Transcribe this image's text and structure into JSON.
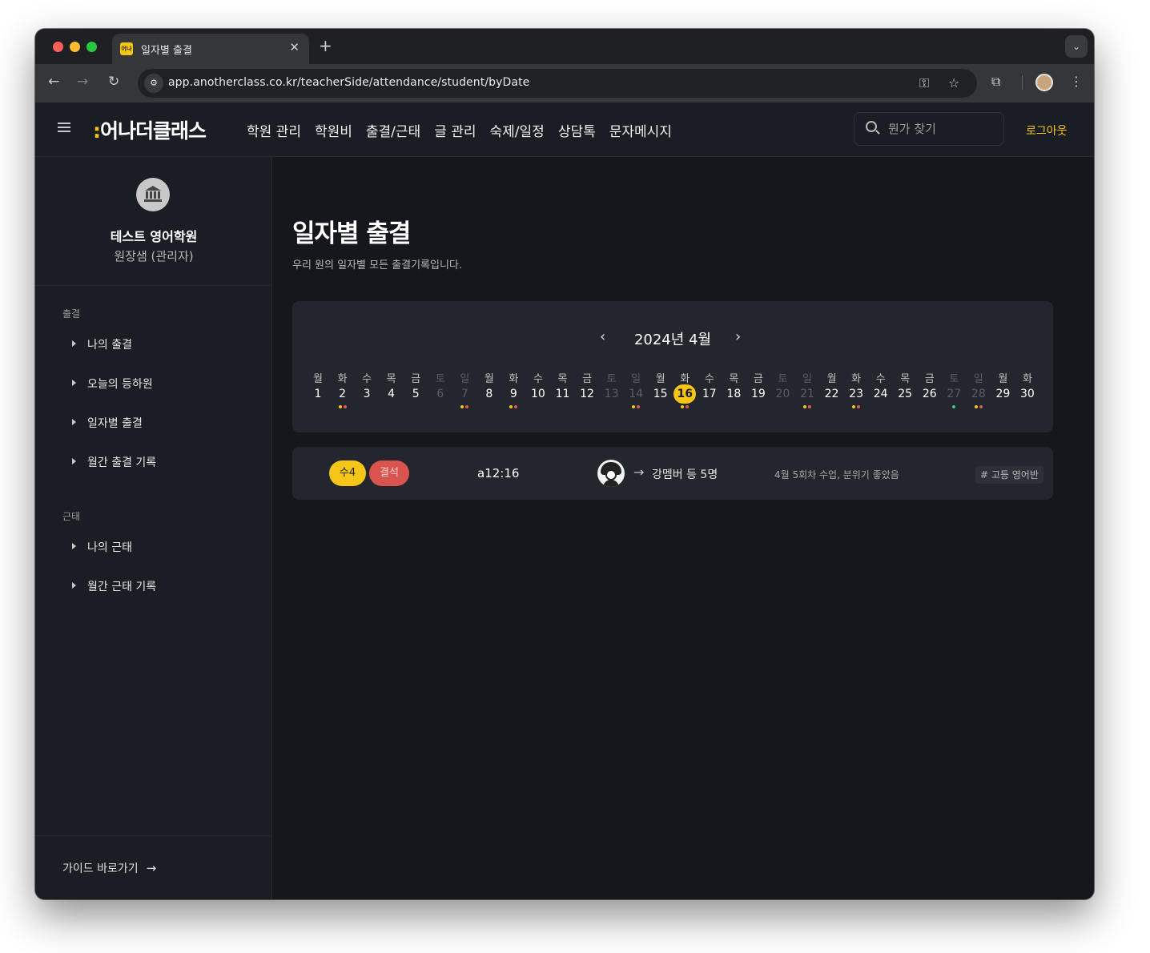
{
  "browser": {
    "tab_title": "일자별 출결",
    "tab_favicon_text": "어나",
    "url": "app.anotherclass.co.kr/teacherSide/attendance/student/byDate"
  },
  "header": {
    "logo_text": "어나더클래스",
    "nav": [
      "학원 관리",
      "학원비",
      "출결/근태",
      "글 관리",
      "숙제/일정",
      "상담톡",
      "문자메시지"
    ],
    "search_placeholder": "뭔가 찾기",
    "logout_label": "로그아웃"
  },
  "sidebar": {
    "org_name": "테스트 영어학원",
    "org_role": "원장샘 (관리자)",
    "sections": [
      {
        "title": "출결",
        "items": [
          "나의 출결",
          "오늘의 등하원",
          "일자별 출결",
          "월간 출결 기록"
        ]
      },
      {
        "title": "근태",
        "items": [
          "나의 근태",
          "월간 근태 기록"
        ]
      }
    ],
    "guide_label": "가이드 바로가기"
  },
  "main": {
    "title": "일자별 출결",
    "subtitle": "우리 원의 일자별 모든 출결기록입니다.",
    "month_label": "2024년 4월",
    "colors": {
      "accent": "#f5c518",
      "absent": "#d9534f",
      "dot_green": "#3fbf8f"
    },
    "days": [
      {
        "wd": "월",
        "d": "1",
        "weekend": false,
        "today": false,
        "dots": []
      },
      {
        "wd": "화",
        "d": "2",
        "weekend": false,
        "today": false,
        "dots": [
          "#f5c518",
          "#e05a4f"
        ]
      },
      {
        "wd": "수",
        "d": "3",
        "weekend": false,
        "today": false,
        "dots": []
      },
      {
        "wd": "목",
        "d": "4",
        "weekend": false,
        "today": false,
        "dots": []
      },
      {
        "wd": "금",
        "d": "5",
        "weekend": false,
        "today": false,
        "dots": []
      },
      {
        "wd": "토",
        "d": "6",
        "weekend": true,
        "today": false,
        "dots": []
      },
      {
        "wd": "일",
        "d": "7",
        "weekend": true,
        "today": false,
        "dots": [
          "#f5c518",
          "#e05a4f"
        ]
      },
      {
        "wd": "월",
        "d": "8",
        "weekend": false,
        "today": false,
        "dots": []
      },
      {
        "wd": "화",
        "d": "9",
        "weekend": false,
        "today": false,
        "dots": [
          "#f5c518",
          "#e05a4f"
        ]
      },
      {
        "wd": "수",
        "d": "10",
        "weekend": false,
        "today": false,
        "dots": []
      },
      {
        "wd": "목",
        "d": "11",
        "weekend": false,
        "today": false,
        "dots": []
      },
      {
        "wd": "금",
        "d": "12",
        "weekend": false,
        "today": false,
        "dots": []
      },
      {
        "wd": "토",
        "d": "13",
        "weekend": true,
        "today": false,
        "dots": []
      },
      {
        "wd": "일",
        "d": "14",
        "weekend": true,
        "today": false,
        "dots": [
          "#f5c518",
          "#e05a4f"
        ]
      },
      {
        "wd": "월",
        "d": "15",
        "weekend": false,
        "today": false,
        "dots": []
      },
      {
        "wd": "화",
        "d": "16",
        "weekend": false,
        "today": true,
        "dots": [
          "#f5c518",
          "#e05a4f"
        ]
      },
      {
        "wd": "수",
        "d": "17",
        "weekend": false,
        "today": false,
        "dots": []
      },
      {
        "wd": "목",
        "d": "18",
        "weekend": false,
        "today": false,
        "dots": []
      },
      {
        "wd": "금",
        "d": "19",
        "weekend": false,
        "today": false,
        "dots": []
      },
      {
        "wd": "토",
        "d": "20",
        "weekend": true,
        "today": false,
        "dots": []
      },
      {
        "wd": "일",
        "d": "21",
        "weekend": true,
        "today": false,
        "dots": [
          "#f5c518",
          "#e05a4f"
        ]
      },
      {
        "wd": "월",
        "d": "22",
        "weekend": false,
        "today": false,
        "dots": []
      },
      {
        "wd": "화",
        "d": "23",
        "weekend": false,
        "today": false,
        "dots": [
          "#f5c518",
          "#e05a4f"
        ]
      },
      {
        "wd": "수",
        "d": "24",
        "weekend": false,
        "today": false,
        "dots": []
      },
      {
        "wd": "목",
        "d": "25",
        "weekend": false,
        "today": false,
        "dots": []
      },
      {
        "wd": "금",
        "d": "26",
        "weekend": false,
        "today": false,
        "dots": []
      },
      {
        "wd": "토",
        "d": "27",
        "weekend": true,
        "today": false,
        "dots": [
          "#3fbf8f"
        ]
      },
      {
        "wd": "일",
        "d": "28",
        "weekend": true,
        "today": false,
        "dots": [
          "#f5c518",
          "#e05a4f"
        ]
      },
      {
        "wd": "월",
        "d": "29",
        "weekend": false,
        "today": false,
        "dots": []
      },
      {
        "wd": "화",
        "d": "30",
        "weekend": false,
        "today": false,
        "dots": []
      }
    ],
    "record": {
      "class_badge": "수4",
      "status_badge": "결석",
      "time": "a12:16",
      "teacher": "강멤버 등 5명",
      "memo": "4월 5회차 수업, 분위기 좋았음",
      "tag": "# 고등 영어반"
    }
  }
}
